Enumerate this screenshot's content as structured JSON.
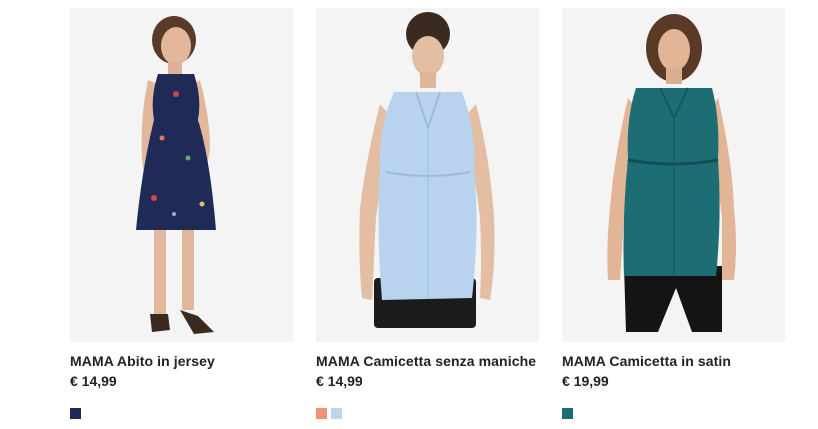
{
  "products": [
    {
      "name": "MAMA Abito in jersey",
      "price": "€ 14,99",
      "image_alt": "",
      "swatches": [
        {
          "color": "#1e2a55",
          "name": "navy-floral"
        }
      ]
    },
    {
      "name": "MAMA Camicetta senza maniche",
      "price": "€ 14,99",
      "image_alt": "",
      "swatches": [
        {
          "color": "#f2907a",
          "name": "coral"
        },
        {
          "color": "#bcd6ee",
          "name": "light-blue"
        }
      ]
    },
    {
      "name": "MAMA Camicetta in satin",
      "price": "€ 19,99",
      "image_alt": "",
      "swatches": [
        {
          "color": "#1d6d74",
          "name": "teal"
        }
      ]
    }
  ],
  "colors": {
    "image_bg": "#f4f4f4",
    "text": "#222222"
  }
}
